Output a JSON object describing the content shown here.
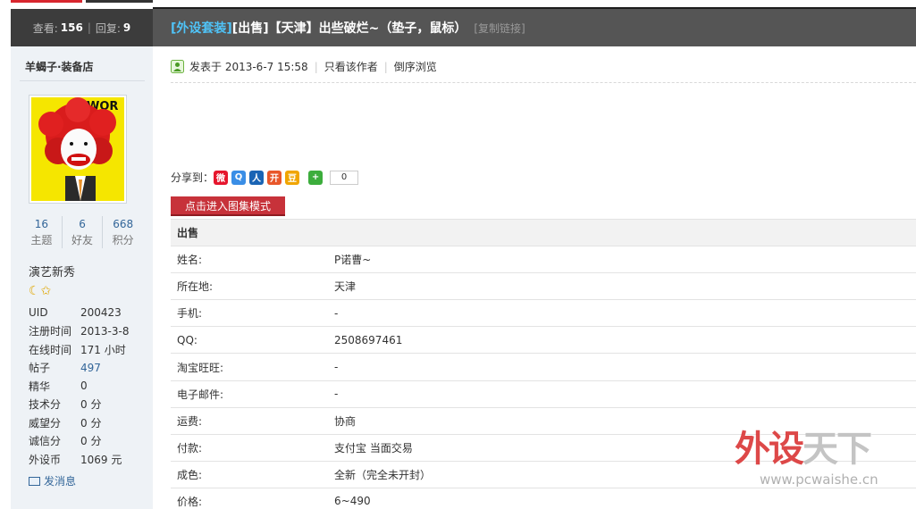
{
  "header": {
    "views_label": "查看:",
    "views": "156",
    "separator": "|",
    "replies_label": "回复:",
    "replies": "9",
    "category": "[外设套装]",
    "tag_sell": "[出售]",
    "tag_city": "【天津】",
    "title": "出些破烂~（垫子，鼠标）",
    "copy_link": "[复制链接]"
  },
  "author": {
    "name": "羊蝎子·装备店",
    "counts": [
      {
        "num": "16",
        "label": "主题"
      },
      {
        "num": "6",
        "label": "好友"
      },
      {
        "num": "668",
        "label": "积分"
      }
    ],
    "rank": "演艺新秀",
    "rank_icons": "☾✩",
    "info": [
      {
        "key": "UID",
        "value": "200423"
      },
      {
        "key": "注册时间",
        "value": "2013-3-8"
      },
      {
        "key": "在线时间",
        "value": "171 小时"
      },
      {
        "key": "帖子",
        "value": "497"
      },
      {
        "key": "精华",
        "value": "0"
      },
      {
        "key": "技术分",
        "value": "0 分"
      },
      {
        "key": "威望分",
        "value": "0 分"
      },
      {
        "key": "诚信分",
        "value": "0 分"
      },
      {
        "key": "外设币",
        "value": "1069 元"
      }
    ],
    "send_message": "发消息"
  },
  "post": {
    "posted_label": "发表于 2013-6-7 15:58",
    "only_author": "只看该作者",
    "reverse_order": "倒序浏览",
    "pipe": "|"
  },
  "share": {
    "label": "分享到：",
    "count": "0",
    "icons": [
      "weibo-icon",
      "qzone-icon",
      "renren-icon",
      "kaixin-icon",
      "douban-icon",
      "more-icon"
    ]
  },
  "gallery_button": "点击进入图集模式",
  "spec": {
    "header": "出售",
    "rows": [
      {
        "key": "姓名:",
        "value": "P诺曹~"
      },
      {
        "key": "所在地:",
        "value": "天津"
      },
      {
        "key": "手机:",
        "value": "-"
      },
      {
        "key": "QQ:",
        "value": "2508697461"
      },
      {
        "key": "淘宝旺旺:",
        "value": "-"
      },
      {
        "key": "电子邮件:",
        "value": "-"
      },
      {
        "key": "运费:",
        "value": "协商"
      },
      {
        "key": "付款:",
        "value": "支付宝 当面交易"
      },
      {
        "key": "成色:",
        "value": "全新（完全未开封）"
      },
      {
        "key": "价格:",
        "value": "6~490"
      }
    ]
  },
  "watermark": {
    "title_red": "外设",
    "title_gray": "天下",
    "url": "www.pcwaishe.cn"
  },
  "colors": {
    "title_bar": "#555555",
    "stats_bar": "#3c3c3c",
    "sidebar_bg": "#eef2f6",
    "category_link": "#4fc3f7",
    "gallery_button": "#c7323a",
    "link": "#336699"
  }
}
